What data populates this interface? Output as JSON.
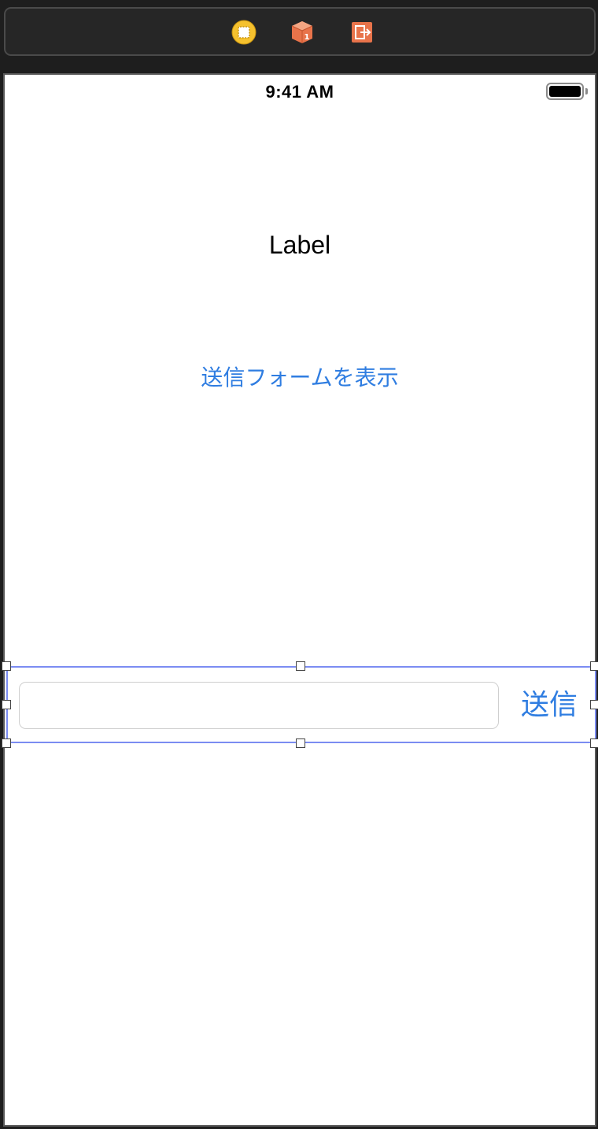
{
  "scene_dock": {
    "icons": [
      "view-controller-icon",
      "first-responder-icon",
      "exit-icon"
    ],
    "colors": {
      "view_controller": "#f5c12e",
      "first_responder": "#e8734a",
      "exit": "#e8734a"
    }
  },
  "status_bar": {
    "time": "9:41 AM",
    "battery_level": 1.0
  },
  "view": {
    "label_text": "Label",
    "show_form_button": "送信フォームを表示"
  },
  "input_accessory": {
    "text_field": {
      "value": "",
      "placeholder": ""
    },
    "send_button": "送信"
  },
  "colors": {
    "tint": "#2f7de1",
    "selection": "#7b8cf2",
    "canvas": "#1e1e1e"
  }
}
